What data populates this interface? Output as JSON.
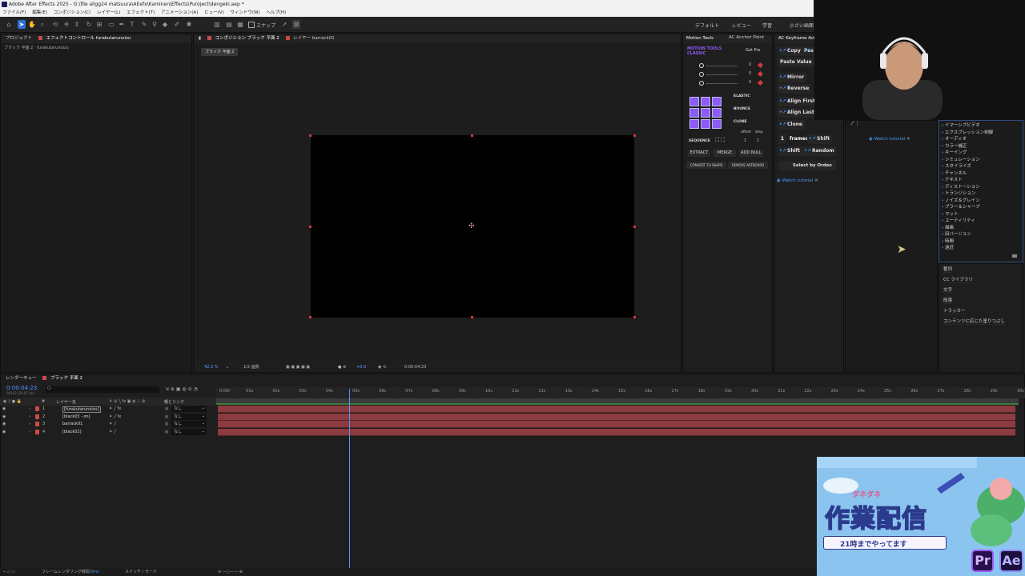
{
  "app": {
    "title": "Adobe After Effects 2025 - G:\\file aligg24 matsuura\\AEefx\\Kaminen\\Effects\\Puroject\\dengeki.aep *"
  },
  "menu": [
    "ファイル(F)",
    "編集(E)",
    "コンポジション(C)",
    "レイヤー(L)",
    "エフェクト(T)",
    "アニメーション(A)",
    "ビュー(V)",
    "ウィンドウ(W)",
    "ヘルプ(H)"
  ],
  "toolbar": {
    "snap_label": "スナップ",
    "workspaces": [
      "デフォルト",
      "レビュー",
      "学習",
      "小さい画面"
    ]
  },
  "project_panel": {
    "tab_project": "プロジェクト",
    "tab_effect_controls": "エフェクトコントロール furakutarunoizu",
    "subtitle": "ブラック 平面 2 · furakutarunoizu"
  },
  "comp_panel": {
    "tab_comp": "コンポジション ブラック 平面 2",
    "tab_layer": "レイヤー barrack01",
    "comp_chip": "ブラック 平面 2",
    "zoom": "42.2 %",
    "resolution": "1/2 画質",
    "exposure": "+0.0",
    "timecode": "0:00:04:23"
  },
  "motion_tools": {
    "tab": "Motion Tools",
    "tab2": "AC Anchor Point",
    "brand": "MOTION TOOLS\nCLASSIC",
    "get_pro": "Get Pro",
    "slider_values": [
      "0",
      "0",
      "0"
    ],
    "elastic": "ELASTIC",
    "bounce": "BOUNCE",
    "clone": "CLONE",
    "offset": "offset",
    "step": "step",
    "sequence": "SEQUENCE",
    "seq_val1": "1",
    "seq_val2": "1",
    "extract": "EXTRACT",
    "merge": "MERGE",
    "add_null": "ADD NULL",
    "convert_to_shape": "CONVERT TO SHAPE",
    "remove_artboard": "REMOVE ARTBOARD"
  },
  "keyframe_panel": {
    "tab": "AC Keyframe Act",
    "copy": "Copy",
    "paste": "Pas",
    "paste_value": "Paste Value",
    "mirror": "Mirror",
    "reverse": "Reverse",
    "align_first": "Align First",
    "align_last": "Align Last",
    "clone": "Clone",
    "frames_value": "1",
    "frames": "frames",
    "shift": "Shift",
    "shift2": "Shift",
    "random": "Random",
    "select_by_order": "Select by Order",
    "watch_tutorial": "Watch tutorial"
  },
  "anchor_panel": {
    "watch_tutorial": "Watch tutorial"
  },
  "effects_list": {
    "categories": [
      "イマーシブビデオ",
      "エクスプレッション制御",
      "オーディオ",
      "カラー補正",
      "キーイング",
      "シミュレーション",
      "スタイライズ",
      "チャンネル",
      "テキスト",
      "ディストーション",
      "トランジション",
      "ノイズ＆グレイン",
      "ブラー＆シャープ",
      "マット",
      "ユーティリティ",
      "描画",
      "旧バージョン",
      "時間",
      "遠近"
    ],
    "panels": [
      "整列",
      "CC ライブラリ",
      "文字",
      "段落",
      "トラッカー",
      "コンテンツに応じた塗りつぶし"
    ]
  },
  "timeline": {
    "tab_render": "レンダーキュー",
    "tab_comp": "ブラック 平面 2",
    "timecode": "0:00:04:23",
    "frame_info": "00143 (29.97 fps)",
    "search_placeholder": "Q-",
    "col_layer_name": "レイヤー名",
    "col_parent": "親とリンク",
    "ruler": [
      "0:00f",
      "01s",
      "02s",
      "03s",
      "04s",
      "05s",
      "06s",
      "07s",
      "08s",
      "09s",
      "10s",
      "11s",
      "12s",
      "13s",
      "14s",
      "15s",
      "16s",
      "17s",
      "18s",
      "19s",
      "20s",
      "21s",
      "22s",
      "23s",
      "24s",
      "25s",
      "26s",
      "27s",
      "28s",
      "29s",
      "30s"
    ],
    "layers": [
      {
        "num": "1",
        "name": "[furakutarunoizu]",
        "parent": "なし"
      },
      {
        "num": "2",
        "name": "[black03 ··on]",
        "parent": "なし"
      },
      {
        "num": "3",
        "name": "barrack01",
        "parent": "なし"
      },
      {
        "num": "4",
        "name": "[black02]",
        "parent": "なし"
      }
    ],
    "playhead_fraction": 0.165,
    "footer_render_time_label": "フレームレンダリング時間",
    "footer_render_time": "0ms",
    "footer_switch": "スイッチ / モード"
  },
  "overlay": {
    "banner_small": "ダネダネ",
    "banner_title": "作業配信",
    "banner_sub": "21時までやってます",
    "badge_pr": "Pr",
    "badge_ae": "Ae"
  },
  "colors": {
    "accent_blue": "#2f6fd6",
    "layer_bar": "#8c3b40",
    "handle_red": "#d23b3b",
    "motion_purple": "#8b5cf6"
  }
}
